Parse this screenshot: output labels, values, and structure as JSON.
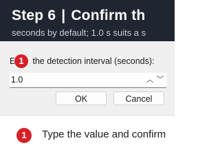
{
  "banner": {
    "step": "Step 6",
    "separator": "|",
    "title": "Confirm th",
    "subtitle": "seconds by default; 1.0 s suits a s"
  },
  "dialog": {
    "prompt_start": "E",
    "prompt_rest": "the detection interval (seconds):",
    "marker": "1",
    "input_value": "1.0",
    "spin_up": "︿",
    "spin_down": "﹀",
    "ok_label": "OK",
    "cancel_label": "Cancel"
  },
  "instruction": {
    "marker": "1",
    "text": "Type the value and confirm"
  },
  "colors": {
    "banner_bg": "#1f2631",
    "marker_red": "#d81f26",
    "dialog_bg": "#f0f0f0"
  }
}
